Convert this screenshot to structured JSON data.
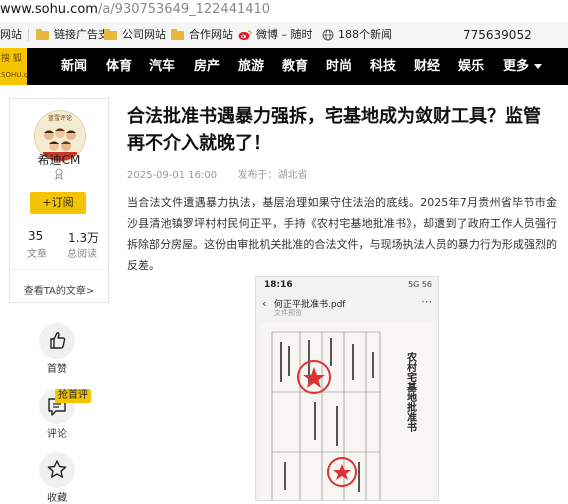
{
  "browser": {
    "url_host": "www.sohu.com",
    "url_path": "/a/930753649_122441410",
    "bookmarks": [
      {
        "label": "网站",
        "icon": "partial"
      },
      {
        "label": "链接广告支",
        "icon": "folder-icon"
      },
      {
        "label": "公司网站",
        "icon": "folder-icon"
      },
      {
        "label": "合作网站",
        "icon": "folder-icon"
      },
      {
        "label": "微博 – 随时",
        "icon": "weibo-icon"
      },
      {
        "label": "188个新闻",
        "icon": "globe-icon"
      },
      {
        "label": "775639052",
        "icon": "none"
      }
    ]
  },
  "nav": {
    "logo_top": "搜 狐",
    "logo_bottom": "SOHU.com",
    "items": [
      "新闻",
      "体育",
      "汽车",
      "房产",
      "旅游",
      "教育",
      "时尚",
      "科技",
      "财经",
      "娱乐",
      "更多"
    ],
    "bg_color": "#000000",
    "logo_color": "#f5c400"
  },
  "author": {
    "avatar_caption": "蓝雪评论",
    "name": "希迪CM",
    "follow_label": "+订阅",
    "articles_count": "35",
    "articles_label": "文章",
    "views_count": "1.3万",
    "views_label": "总阅读",
    "see_more": "查看TA的文章>"
  },
  "actions": [
    {
      "name": "like",
      "label": "首赞",
      "icon": "thumbs-up-icon"
    },
    {
      "name": "comment",
      "label": "评论",
      "icon": "comment-icon",
      "badge": "抢首评"
    },
    {
      "name": "favorite",
      "label": "收藏",
      "icon": "star-icon"
    }
  ],
  "article": {
    "title": "合法批准书遇暴力强拆，宅基地成为敛财工具？监管再不介入就晚了！",
    "date": "2025-09-01 16:00",
    "source": "发布于：湖北省",
    "paragraph": "当合法文件遭遇暴力执法，基层治理如果守住法治的底线。2025年7月贵州省毕节市金沙县清池镇罗坪村村民何正平，手持《农村宅基地批准书》，却遭到了政府工作人员强行拆除部分房屋。这份由审批机关批准的合法文件，与现场执法人员的暴力行为形成强烈的反差。"
  },
  "embedded_image": {
    "time": "18:16",
    "status_right": "5G 56",
    "file_name": "何正平批准书.pdf",
    "file_sub": "文件预览",
    "doc_title": "农村宅基地批准书"
  }
}
